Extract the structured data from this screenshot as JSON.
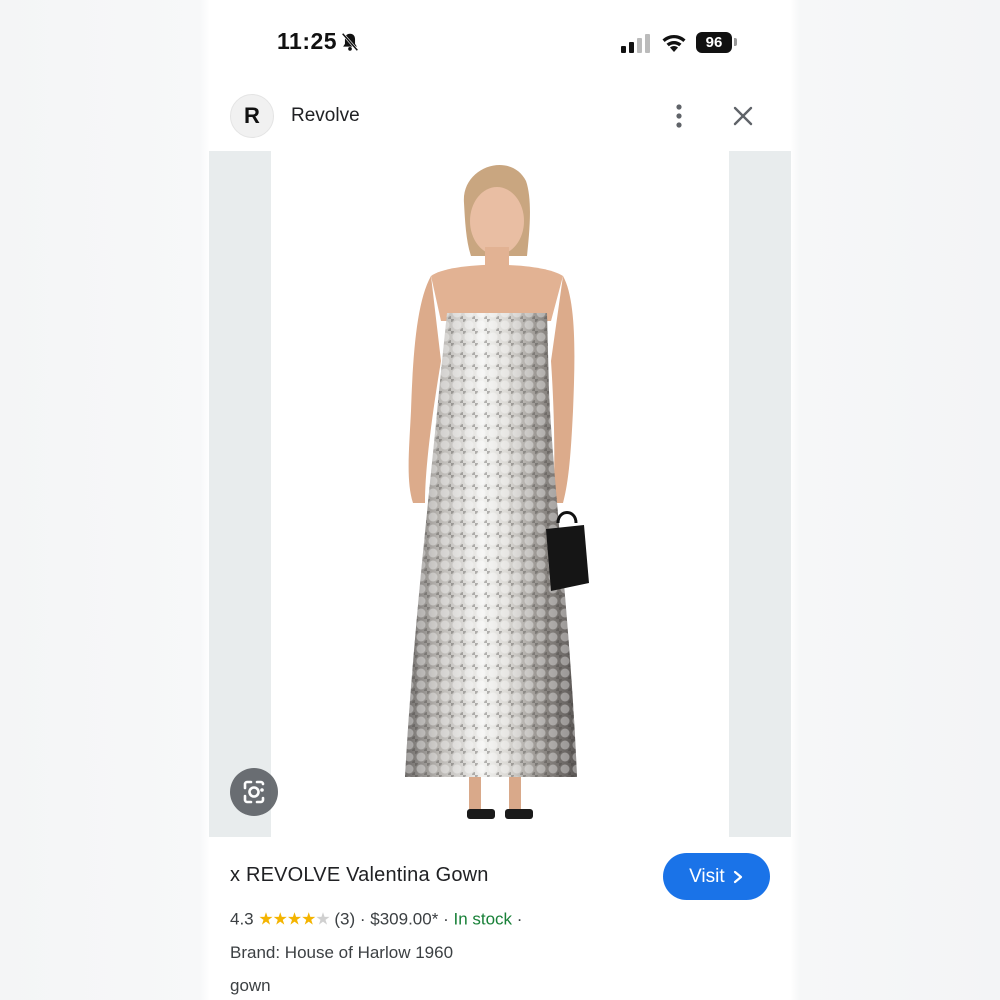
{
  "status_bar": {
    "time": "11:25",
    "battery": "96",
    "icons": [
      "bell-slash-icon",
      "signal-icon",
      "wifi-icon",
      "battery-icon"
    ]
  },
  "header": {
    "logo_letter": "R",
    "site_name": "Revolve",
    "icons": [
      "more-vert-icon",
      "close-icon"
    ]
  },
  "image": {
    "lens_icon": "google-lens-icon"
  },
  "product": {
    "title": "x REVOLVE Valentina Gown",
    "visit_label": "Visit",
    "rating": "4.3",
    "stars_full": "★★★★",
    "stars_empty": "★",
    "review_count": "(3)",
    "sep1": "·",
    "price": "$309.00*",
    "sep2": "·",
    "stock": "In stock",
    "sep3": "·",
    "brand": "Brand: House of Harlow 1960",
    "category": "gown"
  },
  "colors": {
    "accent": "#1a73e8",
    "stock": "#188038",
    "star": "#f4b400"
  }
}
